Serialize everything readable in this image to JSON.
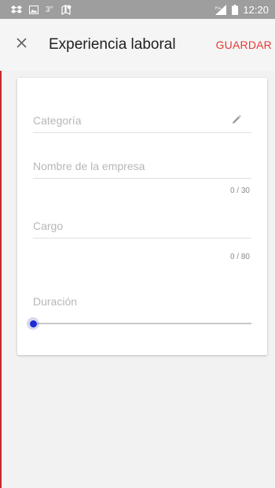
{
  "status_bar": {
    "time": "12:20",
    "icons_left": [
      "dropbox-icon",
      "image-icon",
      "temperature-icon",
      "location-icon"
    ],
    "temperature": "3°",
    "icons_right": [
      "signal-icon",
      "battery-icon"
    ]
  },
  "app_bar": {
    "close_icon": "close-icon",
    "title": "Experiencia laboral",
    "save_label": "GUARDAR"
  },
  "form": {
    "category": {
      "label": "Categoría",
      "icon": "pencil-icon",
      "value": ""
    },
    "company": {
      "label": "Nombre de la empresa",
      "value": "",
      "counter": "0 / 30"
    },
    "position": {
      "label": "Cargo",
      "value": "",
      "counter": "0 / 80"
    },
    "duration": {
      "label": "Duración",
      "value_fraction": 0
    }
  },
  "colors": {
    "accent": "#e53935",
    "slider_thumb": "#1e2bd6",
    "status_bar": "#9e9e9e",
    "label": "#b7b7b7"
  }
}
